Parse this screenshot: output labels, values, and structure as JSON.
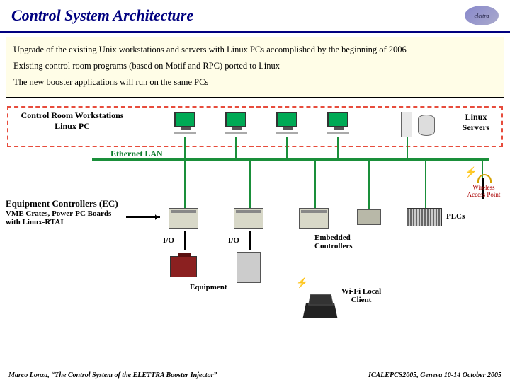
{
  "title": "Control System Architecture",
  "logo_text": "elettra",
  "textbox": {
    "l1": "Upgrade of the existing Unix workstations and servers with Linux PCs accomplished by the beginning of 2006",
    "l2": "Existing control room programs (based on Motif and RPC) ported to Linux",
    "l3": "The new booster applications will run on the same PCs"
  },
  "labels": {
    "crw1": "Control Room Workstations",
    "crw2": "Linux PC",
    "servers1": "Linux",
    "servers2": "Servers",
    "ethernet": "Ethernet LAN",
    "ec": "Equipment Controllers (EC)",
    "ec_sub": "VME Crates, Power-PC Boards with Linux-RTAI",
    "plcs": "PLCs",
    "io": "I/O",
    "equipment": "Equipment",
    "embedded": "Embedded Controllers",
    "wifi": "Wi-Fi Local Client",
    "ap": "Wireless Access Point"
  },
  "footer": {
    "left": "Marco Lonza, “The Control System of the ELETTRA Booster Injector”",
    "right": "ICALEPCS2005, Geneva 10-14 October 2005"
  }
}
